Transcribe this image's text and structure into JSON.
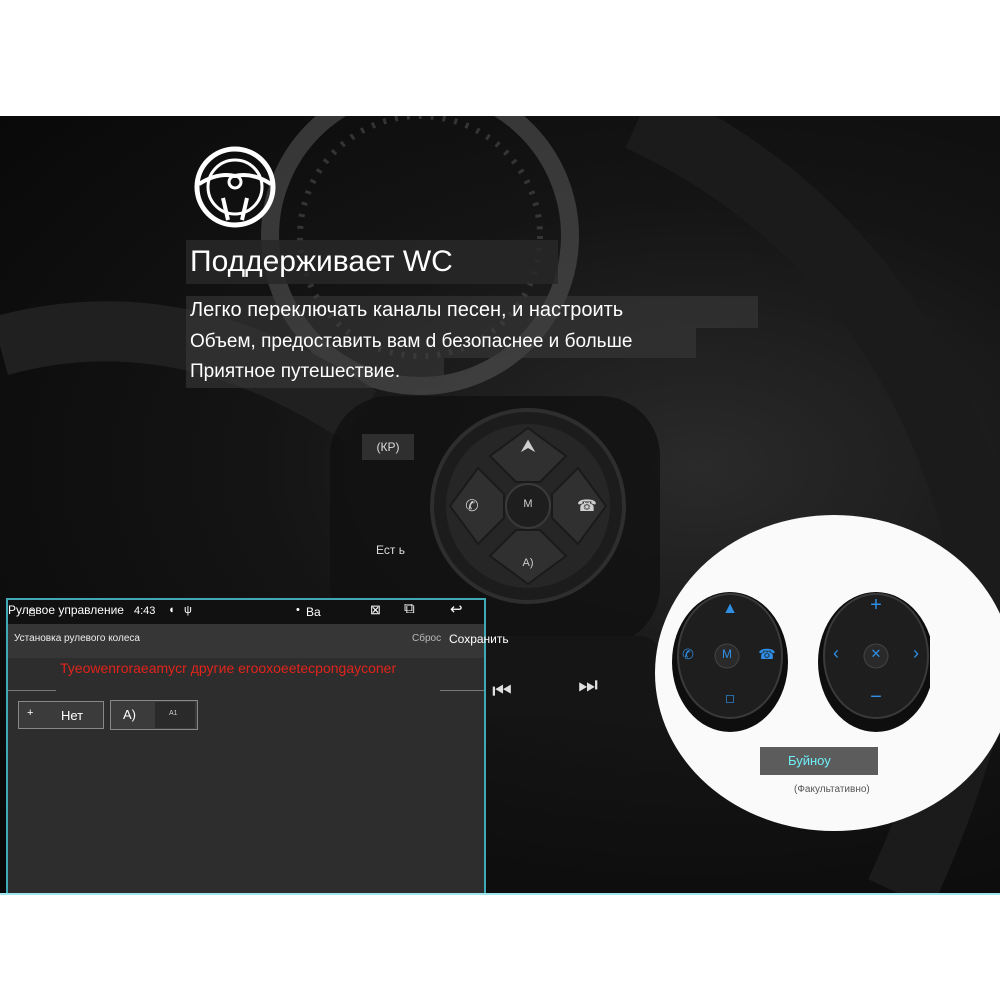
{
  "headline": {
    "title": "Поддерживает WC",
    "line1": "Легко переключать каналы песен, и настроить",
    "line2": "Объем, предоставить вам d безопаснее и больше",
    "line3": "Приятное путешествие."
  },
  "wheel_labels": {
    "kp": "(КР)",
    "yest": "Ест ь",
    "m": "M",
    "a": "A)"
  },
  "head_unit": {
    "status_title": "Рулевое управление",
    "time": "4:43",
    "tab_va": "Ва",
    "subtitle": "Установка рулевого колеса",
    "reset": "Сброс",
    "save": "Сохранить",
    "warning": "Tyeowenroraeamycr другие erooxoeetecpongayconer",
    "key1_plus": "+",
    "key1_label": "Нет",
    "key2_label": "A)",
    "key2_small": "A1"
  },
  "product": {
    "badge": "Буйноу",
    "note": "(Факультативно)"
  },
  "colors": {
    "accent_cyan": "#6ff0f8",
    "warning_red": "#e0241b",
    "button_blue": "#2f8fe6"
  },
  "icons": [
    "steering-wheel-icon",
    "up-arrow-icon",
    "phone-icon",
    "hangup-icon",
    "home-icon",
    "close-icon",
    "window-icon",
    "back-icon",
    "rewind-icon",
    "forward-icon",
    "plus-icon",
    "minus-icon",
    "left-icon",
    "right-icon",
    "mute-icon"
  ]
}
